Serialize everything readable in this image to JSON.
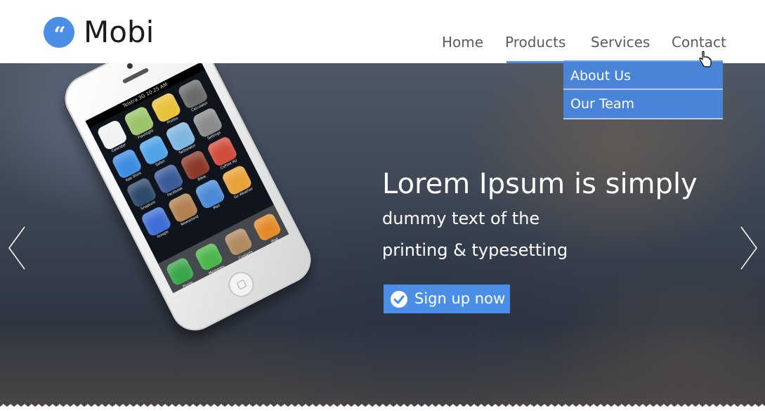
{
  "brand": {
    "logo_glyph": "“",
    "name": "Mobi",
    "color": "#4a8ee6"
  },
  "nav": {
    "items": [
      {
        "label": "Home"
      },
      {
        "label": "Products",
        "active": true
      },
      {
        "label": "Services"
      },
      {
        "label": "Contact"
      }
    ],
    "dropdown": [
      {
        "label": "About Us"
      },
      {
        "label": "Our Team"
      }
    ],
    "dropdown_color": "#4a84d8"
  },
  "hero": {
    "headline": "Lorem Ipsum is simply",
    "sub_line_1": "dummy text of the",
    "sub_line_2": "printing & typesetting",
    "cta_label": "Sign up now",
    "cta_icon": "check-circle-icon",
    "prev_icon": "chevron-left-icon",
    "next_icon": "chevron-right-icon"
  },
  "phone": {
    "status_text": "Telstra 3G   10:25 AM",
    "apps": [
      {
        "label": "Calendar",
        "color": "#f2f2f2"
      },
      {
        "label": "Flashlight",
        "color": "#9bc46a"
      },
      {
        "label": "Photos",
        "color": "#e9c23a"
      },
      {
        "label": "Calculator",
        "color": "#6b6b6b"
      },
      {
        "label": "App Store",
        "color": "#3d8de0"
      },
      {
        "label": "Safari",
        "color": "#4fa3e6"
      },
      {
        "label": "Twittelator",
        "color": "#7fb6e0"
      },
      {
        "label": "Settings",
        "color": "#8b8b8b"
      },
      {
        "label": "Snapture",
        "color": "#2e4a6b"
      },
      {
        "label": "Facebook",
        "color": "#3b5a98"
      },
      {
        "label": "Bible",
        "color": "#8b3a2a"
      },
      {
        "label": "CoPilot AU",
        "color": "#d04c3b"
      },
      {
        "label": "Google",
        "color": "#3f6fd4"
      },
      {
        "label": "Newsstand",
        "color": "#b08050"
      },
      {
        "label": "Mail",
        "color": "#4b8ad6"
      },
      {
        "label": "Go Weather",
        "color": "#e8a23a"
      }
    ],
    "dock": [
      {
        "label": "Phone",
        "color": "#3aa64a"
      },
      {
        "label": "Messages",
        "color": "#4bb54b"
      },
      {
        "label": "Contacts",
        "color": "#b08a60"
      },
      {
        "label": "iPod",
        "color": "#e58a2a"
      }
    ]
  }
}
